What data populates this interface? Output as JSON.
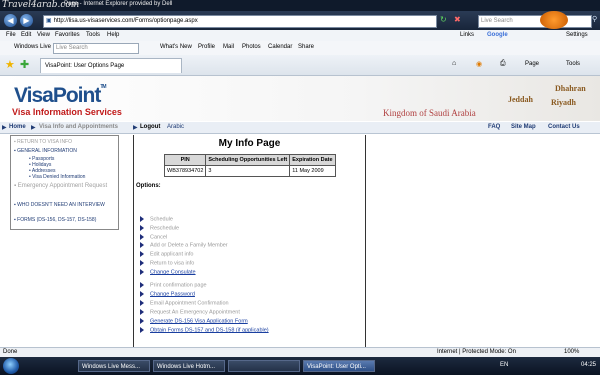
{
  "browser": {
    "watermark": "Travel4arab.com",
    "window_title": "Page - Internet Explorer provided by Dell",
    "address": "http://lisa.us-visaservices.com/Forms/optionpage.aspx",
    "search_placeholder": "Live Search",
    "menu": [
      "File",
      "Edit",
      "View",
      "Favorites",
      "Tools",
      "Help"
    ],
    "links_label": "Links",
    "google_label": "Google",
    "settings_label": "Settings",
    "live_search_label": "Windows Live",
    "live_search_placeholder": "Live Search",
    "live_links": [
      "What's New",
      "Profile",
      "Mail",
      "Photos",
      "Calendar",
      "Share"
    ],
    "tab_title": "VisaPoint: User Options Page",
    "page_menu": "Page",
    "tools_menu": "Tools"
  },
  "banner": {
    "logo": "VisaPoint",
    "logo_tm": "TM",
    "subtitle": "Visa Information Services",
    "country": "Kingdom of Saudi Arabia",
    "cities": [
      "Dhahran",
      "Jeddah",
      "Riyadh"
    ]
  },
  "nav": {
    "home": "Home",
    "visa_info": "Visa Info and Appointments",
    "logout": "Logout",
    "arabic": "Arabic",
    "faq": "FAQ",
    "sitemap": "Site Map",
    "contact": "Contact Us"
  },
  "left_menu": {
    "return": "RETURN TO VISA INFO",
    "general": "GENERAL INFORMATION",
    "sub": [
      "Passports",
      "Holidays",
      "Addresses",
      "Visa Denied Information"
    ],
    "emergency": "Emergency Appointment Request",
    "interview": "WHO DOESN'T NEED AN INTERVIEW",
    "forms": "FORMS (DS-156, DS-157, DS-158)"
  },
  "main": {
    "title": "My Info Page",
    "table": {
      "headers": [
        "PIN",
        "Scheduling Opportunities Left",
        "Expiration Date"
      ],
      "row": [
        "WB378934702",
        "3",
        "11 May 2009"
      ]
    },
    "options_label": "Options:",
    "options": [
      {
        "label": "Schedule",
        "enabled": false
      },
      {
        "label": "Reschedule",
        "enabled": false
      },
      {
        "label": "Cancel",
        "enabled": false
      },
      {
        "label": "Add or Delete a Family Member",
        "enabled": false
      },
      {
        "label": "Edit applicant info",
        "enabled": false
      },
      {
        "label": "Return to visa info",
        "enabled": false
      },
      {
        "label": "Change Consulate",
        "enabled": true
      },
      {
        "label": "Print confirmation page",
        "enabled": false
      },
      {
        "label": "Change Password",
        "enabled": true
      },
      {
        "label": "Email Appointment Confirmation",
        "enabled": false
      },
      {
        "label": "Request An Emergency Appointment",
        "enabled": false
      },
      {
        "label": "Generate DS-156 Visa Application Form",
        "enabled": true
      },
      {
        "label": "Obtain Forms DS-157 and DS-158 (if applicable)",
        "enabled": true
      }
    ]
  },
  "status": {
    "left": "Done",
    "zone": "Internet | Protected Mode: On",
    "zoom": "100%"
  },
  "taskbar": {
    "items": [
      "Windows Live Mess...",
      "Windows Live Hotm...",
      "",
      "VisaPoint: User Opti..."
    ],
    "lang": "EN",
    "clock": "04:25"
  }
}
